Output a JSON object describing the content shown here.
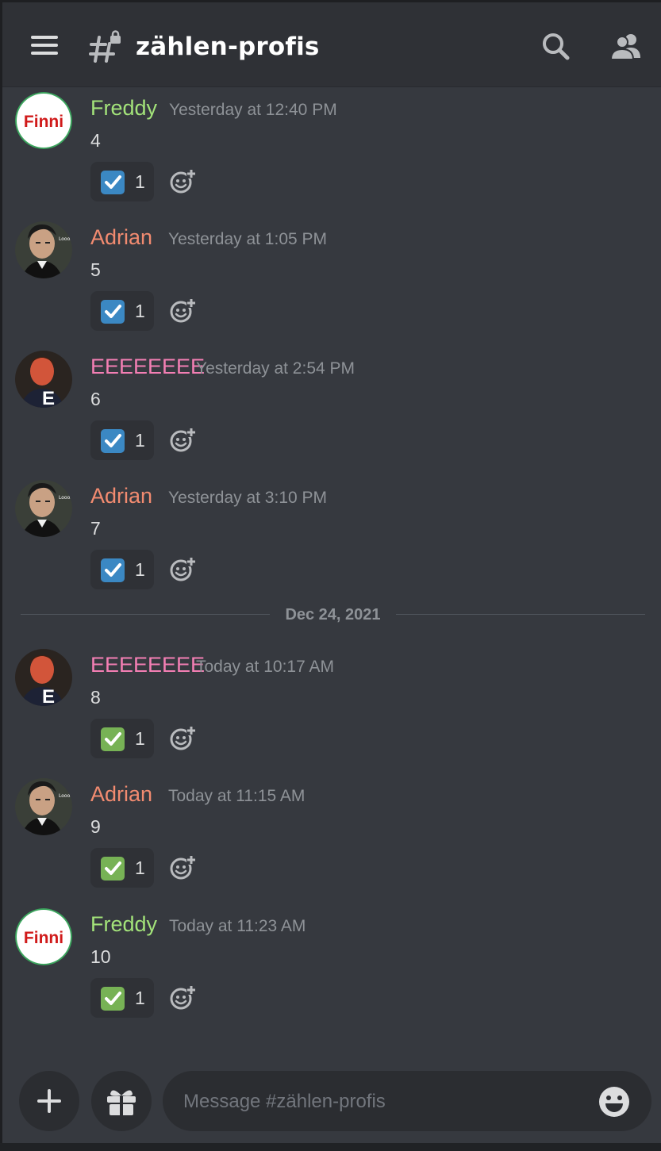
{
  "header": {
    "channel_name": "zählen-profis",
    "menu_icon": "hamburger-menu-icon",
    "channel_icon": "locked-text-channel-icon",
    "search_icon": "search-icon",
    "members_icon": "members-icon"
  },
  "messages": [
    {
      "author": "Freddy",
      "author_color": "#a3e37a",
      "timestamp": "Yesterday at 12:40 PM",
      "content": "4",
      "avatar": "Finni",
      "reaction_count": "1",
      "reaction_style": "blue"
    },
    {
      "author": "Adrian",
      "author_color": "#f28b70",
      "timestamp": "Yesterday at 1:05 PM",
      "content": "5",
      "avatar": "photo",
      "reaction_count": "1",
      "reaction_style": "blue"
    },
    {
      "author": "EEEEEEEE",
      "author_color": "#f47fb4",
      "timestamp": "Yesterday at 2:54 PM",
      "content": "6",
      "avatar": "E",
      "reaction_count": "1",
      "reaction_style": "blue"
    },
    {
      "author": "Adrian",
      "author_color": "#f28b70",
      "timestamp": "Yesterday at 3:10 PM",
      "content": "7",
      "avatar": "photo",
      "reaction_count": "1",
      "reaction_style": "blue"
    },
    {
      "author": "EEEEEEEE",
      "author_color": "#f47fb4",
      "timestamp": "Today at 10:17 AM",
      "content": "8",
      "avatar": "E",
      "reaction_count": "1",
      "reaction_style": "green"
    },
    {
      "author": "Adrian",
      "author_color": "#f28b70",
      "timestamp": "Today at 11:15 AM",
      "content": "9",
      "avatar": "photo",
      "reaction_count": "1",
      "reaction_style": "green"
    },
    {
      "author": "Freddy",
      "author_color": "#a3e37a",
      "timestamp": "Today at 11:23 AM",
      "content": "10",
      "avatar": "Finni",
      "reaction_count": "1",
      "reaction_style": "green"
    }
  ],
  "date_divider": "Dec 24, 2021",
  "composer": {
    "placeholder": "Message #zählen-profis",
    "add_icon": "plus-icon",
    "gift_icon": "gift-icon",
    "emoji_icon": "emoji-icon"
  },
  "colors": {
    "background": "#36393f",
    "header": "#2f3136",
    "reaction_blue": "#3b88c3",
    "reaction_green": "#77b255"
  }
}
